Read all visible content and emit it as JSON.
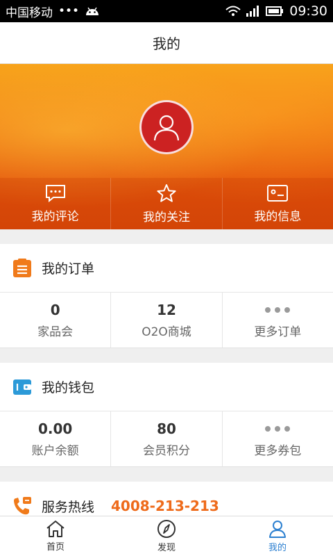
{
  "status_bar": {
    "carrier": "中国移动",
    "dots": "•••",
    "time": "09:30"
  },
  "title": "我的",
  "profile_tabs": [
    {
      "label": "我的评论",
      "icon": "comment-icon"
    },
    {
      "label": "我的关注",
      "icon": "star-icon"
    },
    {
      "label": "我的信息",
      "icon": "id-card-icon"
    }
  ],
  "orders": {
    "title": "我的订单",
    "items": [
      {
        "value": "0",
        "label": "家品会"
      },
      {
        "value": "12",
        "label": "O2O商城"
      },
      {
        "value": "",
        "label": "更多订单"
      }
    ]
  },
  "wallet": {
    "title": "我的钱包",
    "items": [
      {
        "value": "0.00",
        "label": "账户余额"
      },
      {
        "value": "80",
        "label": "会员积分"
      },
      {
        "value": "",
        "label": "更多券包"
      }
    ]
  },
  "hotline": {
    "title": "服务热线",
    "number": "4008-213-213"
  },
  "bottom_nav": [
    {
      "label": "首页",
      "icon": "home-icon"
    },
    {
      "label": "发现",
      "icon": "compass-icon"
    },
    {
      "label": "我的",
      "icon": "user-icon",
      "active": true
    }
  ],
  "colors": {
    "accent": "#ee6a1a",
    "active_nav": "#2b7fd0",
    "banner_top": "#f7a118",
    "banner_bottom": "#d94a0a"
  }
}
